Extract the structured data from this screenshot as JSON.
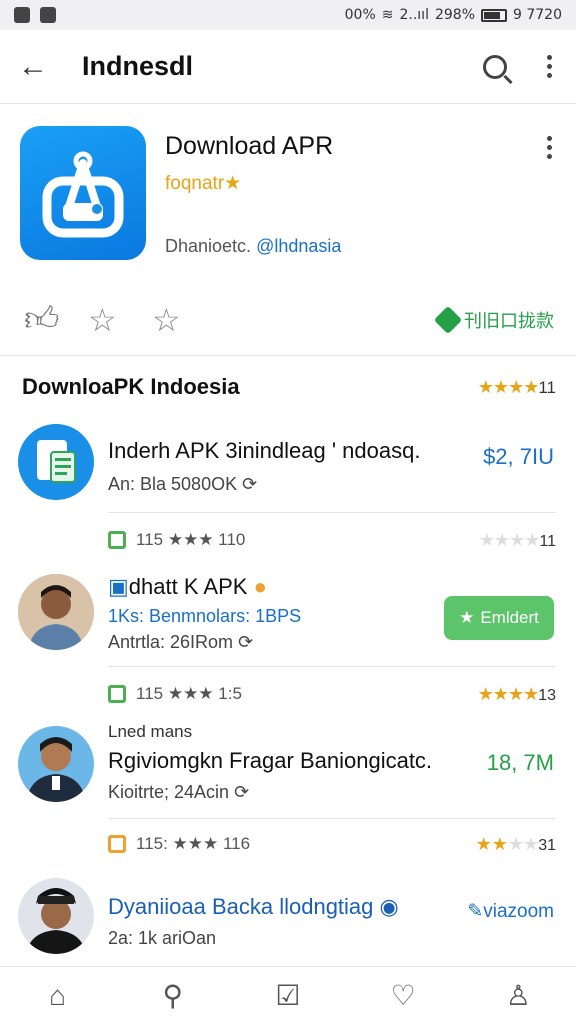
{
  "status_bar": {
    "signal_text": "00% ",
    "network_text": "2..ııl",
    "battery_percent": "298%",
    "time": "9 7720"
  },
  "app_bar": {
    "title": "Indnesdl"
  },
  "app": {
    "title": "Download APR",
    "rating_label": "foqnatr",
    "developer_prefix": "Dhanioetc.",
    "developer_link": "@lhdnasia"
  },
  "actions": {
    "install_badge": "刊旧口拢款"
  },
  "section": {
    "title": "DownloaPK Indoesia",
    "rating_count": "11"
  },
  "items": [
    {
      "title": "Inderh APK 3inindleag ' ndoasq.",
      "sub": "An: Bla 5080OK",
      "price": "$2, 7IU"
    },
    {
      "title": "dhatt K APK",
      "sub1": "1Ks: Benmnolars: 1BPS",
      "sub2": "Antrtla: 26IRom",
      "button": "Emldert"
    },
    {
      "pre": "Lned mans",
      "title": "Rgiviomgkn Fragar Baniongicatc.",
      "sub": "Kioitrte; 24Acin",
      "price": "18, 7M"
    },
    {
      "title": "Dyaniioaa Backa llodngtiag",
      "sub": "2a: 1k ariOan",
      "price": "viazoom"
    }
  ],
  "meta_rows": [
    {
      "text": "115 ★★★ 110",
      "rating_count": "11"
    },
    {
      "text": "115 ★★★ 1:5",
      "rating_count": "13"
    },
    {
      "text": "115: ★★★ 116",
      "rating_count": "31"
    }
  ],
  "bottom_nav": [
    "home",
    "search",
    "library",
    "wishlist",
    "profile"
  ]
}
